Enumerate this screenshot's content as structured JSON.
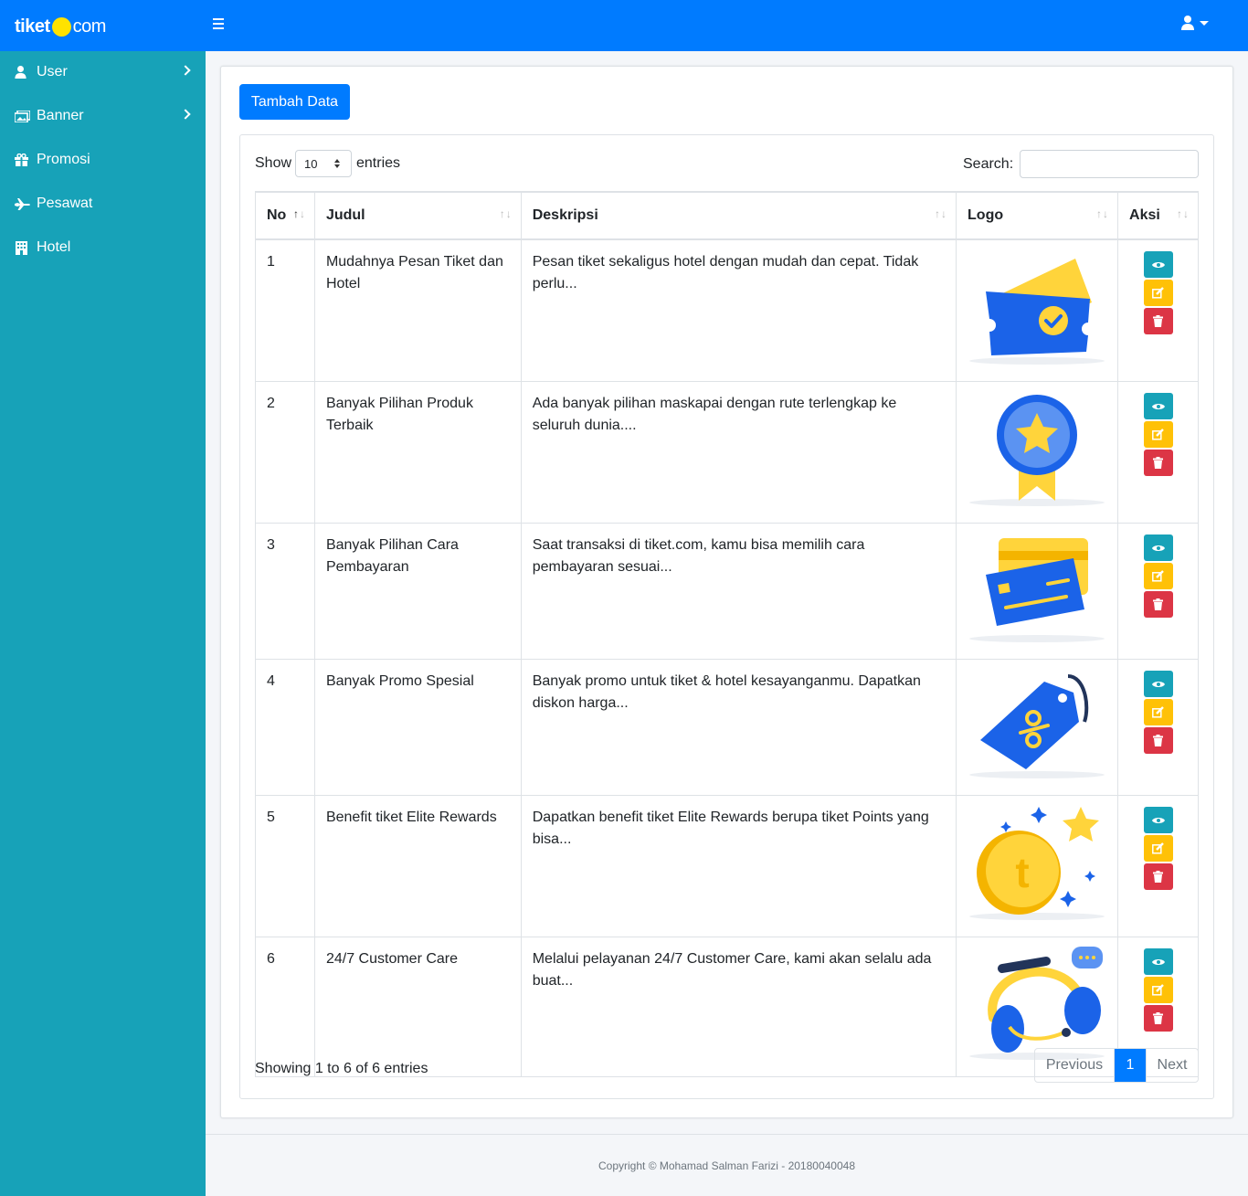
{
  "brand": {
    "part1": "tiket",
    "part2": "com",
    "dot_color": "#ffe200"
  },
  "colors": {
    "primary": "#007bff",
    "sidebar": "#17a2b8",
    "view": "#17a2b8",
    "edit": "#ffc107",
    "delete": "#dc3545"
  },
  "header": {
    "menu_icon": "bars-icon",
    "user_icon": "user-icon"
  },
  "sidebar": {
    "items": [
      {
        "label": "User",
        "icon": "user-icon",
        "has_submenu": true
      },
      {
        "label": "Banner",
        "icon": "images-icon",
        "has_submenu": true
      },
      {
        "label": "Promosi",
        "icon": "gift-icon",
        "has_submenu": false
      },
      {
        "label": "Pesawat",
        "icon": "plane-icon",
        "has_submenu": false
      },
      {
        "label": "Hotel",
        "icon": "hotel-icon",
        "has_submenu": false
      }
    ]
  },
  "toolbar": {
    "add_label": "Tambah Data"
  },
  "table_controls": {
    "show_label": "Show",
    "page_length": "10",
    "entries_label": "entries",
    "search_label": "Search:",
    "search_value": ""
  },
  "table": {
    "columns": [
      "No",
      "Judul",
      "Deskripsi",
      "Logo",
      "Aksi"
    ],
    "rows": [
      {
        "no": "1",
        "judul": "Mudahnya Pesan Tiket dan Hotel",
        "deskripsi": "Pesan tiket sekaligus hotel dengan mudah dan cepat. Tidak perlu...",
        "logo": "ticket-icon"
      },
      {
        "no": "2",
        "judul": "Banyak Pilihan Produk Terbaik",
        "deskripsi": "Ada banyak pilihan maskapai dengan rute terlengkap ke seluruh dunia....",
        "logo": "medal-icon"
      },
      {
        "no": "3",
        "judul": "Banyak Pilihan Cara Pembayaran",
        "deskripsi": "Saat transaksi di tiket.com, kamu bisa memilih cara pembayaran sesuai...",
        "logo": "credit-card-icon"
      },
      {
        "no": "4",
        "judul": "Banyak Promo Spesial",
        "deskripsi": "Banyak promo untuk tiket & hotel kesayanganmu. Dapatkan diskon harga...",
        "logo": "discount-tag-icon"
      },
      {
        "no": "5",
        "judul": "Benefit tiket Elite Rewards",
        "deskripsi": "Dapatkan benefit tiket Elite Rewards berupa tiket Points yang bisa...",
        "logo": "coin-star-icon"
      },
      {
        "no": "6",
        "judul": "24/7 Customer Care",
        "deskripsi": "Melalui pelayanan 24/7 Customer Care, kami akan selalu ada buat...",
        "logo": "headset-icon"
      }
    ],
    "actions": [
      "eye-icon",
      "edit-icon",
      "trash-icon"
    ]
  },
  "pagination": {
    "info": "Showing 1 to 6 of 6 entries",
    "previous": "Previous",
    "current": "1",
    "next": "Next"
  },
  "footer": {
    "text": "Copyright © Mohamad Salman Farizi - 20180040048"
  }
}
